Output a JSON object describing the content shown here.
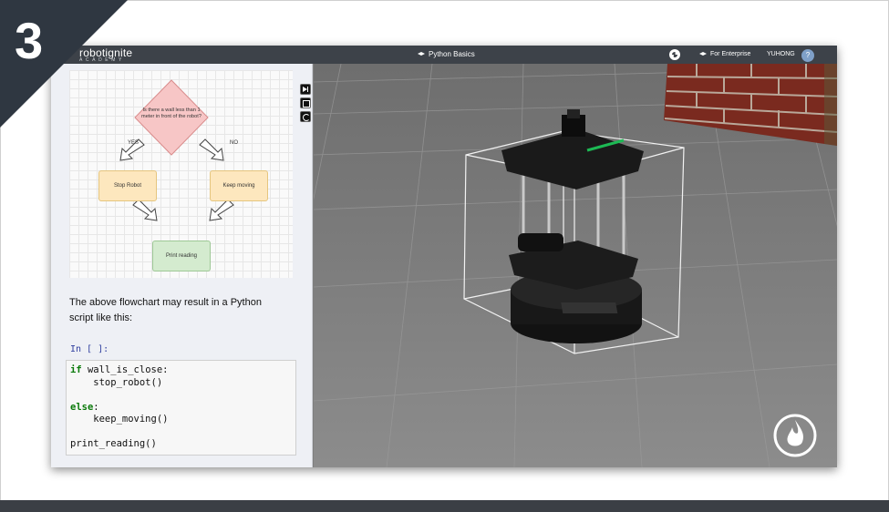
{
  "badge": {
    "number": "3"
  },
  "header": {
    "logo_main": "robotignite",
    "logo_sub": "ACADEMY",
    "course_title": "Python Basics",
    "enterprise_label": "For Enterprise",
    "user_name": "YUHONG",
    "help_label": "?"
  },
  "flowchart": {
    "decision": "Is there a wall less than 1 meter in front of the robot?",
    "yes_label": "YES",
    "no_label": "NO",
    "stop_box": "Stop Robot",
    "keep_box": "Keep moving",
    "print_box": "Print reading"
  },
  "notebook": {
    "paragraph": "The above flowchart may result in a Python script like this:",
    "prompt": "In [ ]:",
    "code_lines": [
      "if wall_is_close:",
      "    stop_robot()",
      "",
      "else:",
      "    keep_moving()",
      "",
      "print_reading()"
    ]
  },
  "icons": [
    "globe-icon",
    "graduation-cap-icon",
    "help-icon",
    "next-cell-icon",
    "stop-icon",
    "reload-icon",
    "flame-logo-icon"
  ],
  "colors": {
    "topbar": "#3d4249",
    "flow_yellow": "#fde7be",
    "flow_green": "#d4ebcf",
    "decision_red": "#f7c6c6",
    "keyword_green": "#0a7a0a"
  }
}
